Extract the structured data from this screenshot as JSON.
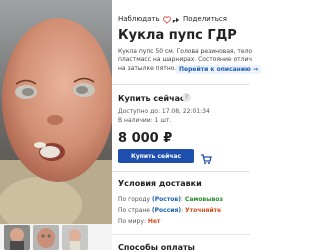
{
  "toolbar": {
    "favorite_label": "Наблюдать",
    "share_label": "Поделиться"
  },
  "product": {
    "title": "Кукла пупс ГДР",
    "description_lines": [
      "Кукла пупс 50 см. Голова резиновая, тело мя",
      "пластмасс на шарнирах. Состояние отличное",
      "на затылке пятно."
    ],
    "description_link": "Перейти к описанию →"
  },
  "buy": {
    "title": "Купить сейчас",
    "help": "?",
    "available_label": "Доступно до: 17.08, 22:01:34",
    "stock_label": "В наличии: 1 шт.",
    "price": "8 000 ₽",
    "button_label": "Купить сейчас"
  },
  "delivery": {
    "title": "Условия доставки",
    "rows": [
      {
        "label": "По городу",
        "place": "(Ростов)",
        "value": "Самовывоз"
      },
      {
        "label": "По стране",
        "place": "(Россия)",
        "value": "Уточняйте"
      },
      {
        "label": "По миру",
        "place": "",
        "value": "Нет"
      }
    ]
  },
  "payment": {
    "title": "Способы оплаты"
  },
  "colors": {
    "accent": "#1e4fae",
    "link": "#1a5fb4",
    "pickup": "#2a8a2a",
    "none": "#d64a1a"
  },
  "icons": [
    "heart-icon",
    "share-icon",
    "cart-icon",
    "help-icon"
  ]
}
